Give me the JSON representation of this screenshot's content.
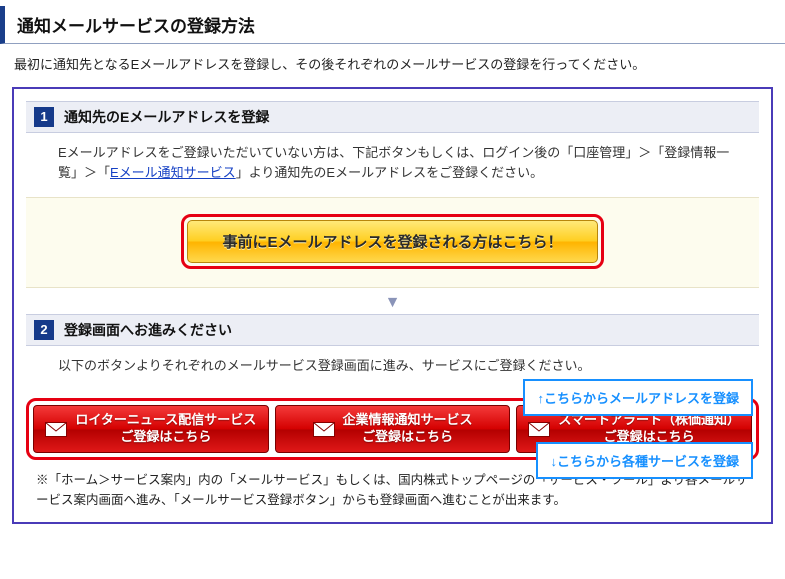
{
  "page_title": "通知メールサービスの登録方法",
  "intro": "最初に通知先となるEメールアドレスを登録し、その後それぞれのメールサービスの登録を行ってください。",
  "step1": {
    "num": "1",
    "title": "通知先のEメールアドレスを登録",
    "body_pre": "Eメールアドレスをご登録いただいていない方は、下記ボタンもしくは、ログイン後の「口座管理」＞「登録情報一覧」＞「",
    "link": "Eメール通知サービス",
    "body_post": "」より通知先のEメールアドレスをご登録ください。",
    "button": "事前にEメールアドレスを登録される方はこちら！"
  },
  "arrow": "▼",
  "step2": {
    "num": "2",
    "title": "登録画面へお進みください",
    "body": "以下のボタンよりそれぞれのメールサービス登録画面に進み、サービスにご登録ください。"
  },
  "callout1": "↑こちらからメールアドレスを登録",
  "callout2": "↓こちらから各種サービスを登録",
  "services": [
    {
      "line1": "ロイターニュース配信サービス",
      "line2": "ご登録はこちら"
    },
    {
      "line1": "企業情報通知サービス",
      "line2": "ご登録はこちら"
    },
    {
      "line1": "スマートアラート（株価通知）",
      "line2": "ご登録はこちら"
    }
  ],
  "note": "※「ホーム＞サービス案内」内の「メールサービス」もしくは、国内株式トップページの「サービス・ツール」より各メールサービス案内画面へ進み、「メールサービス登録ボタン」からも登録画面へ進むことが出来ます。"
}
